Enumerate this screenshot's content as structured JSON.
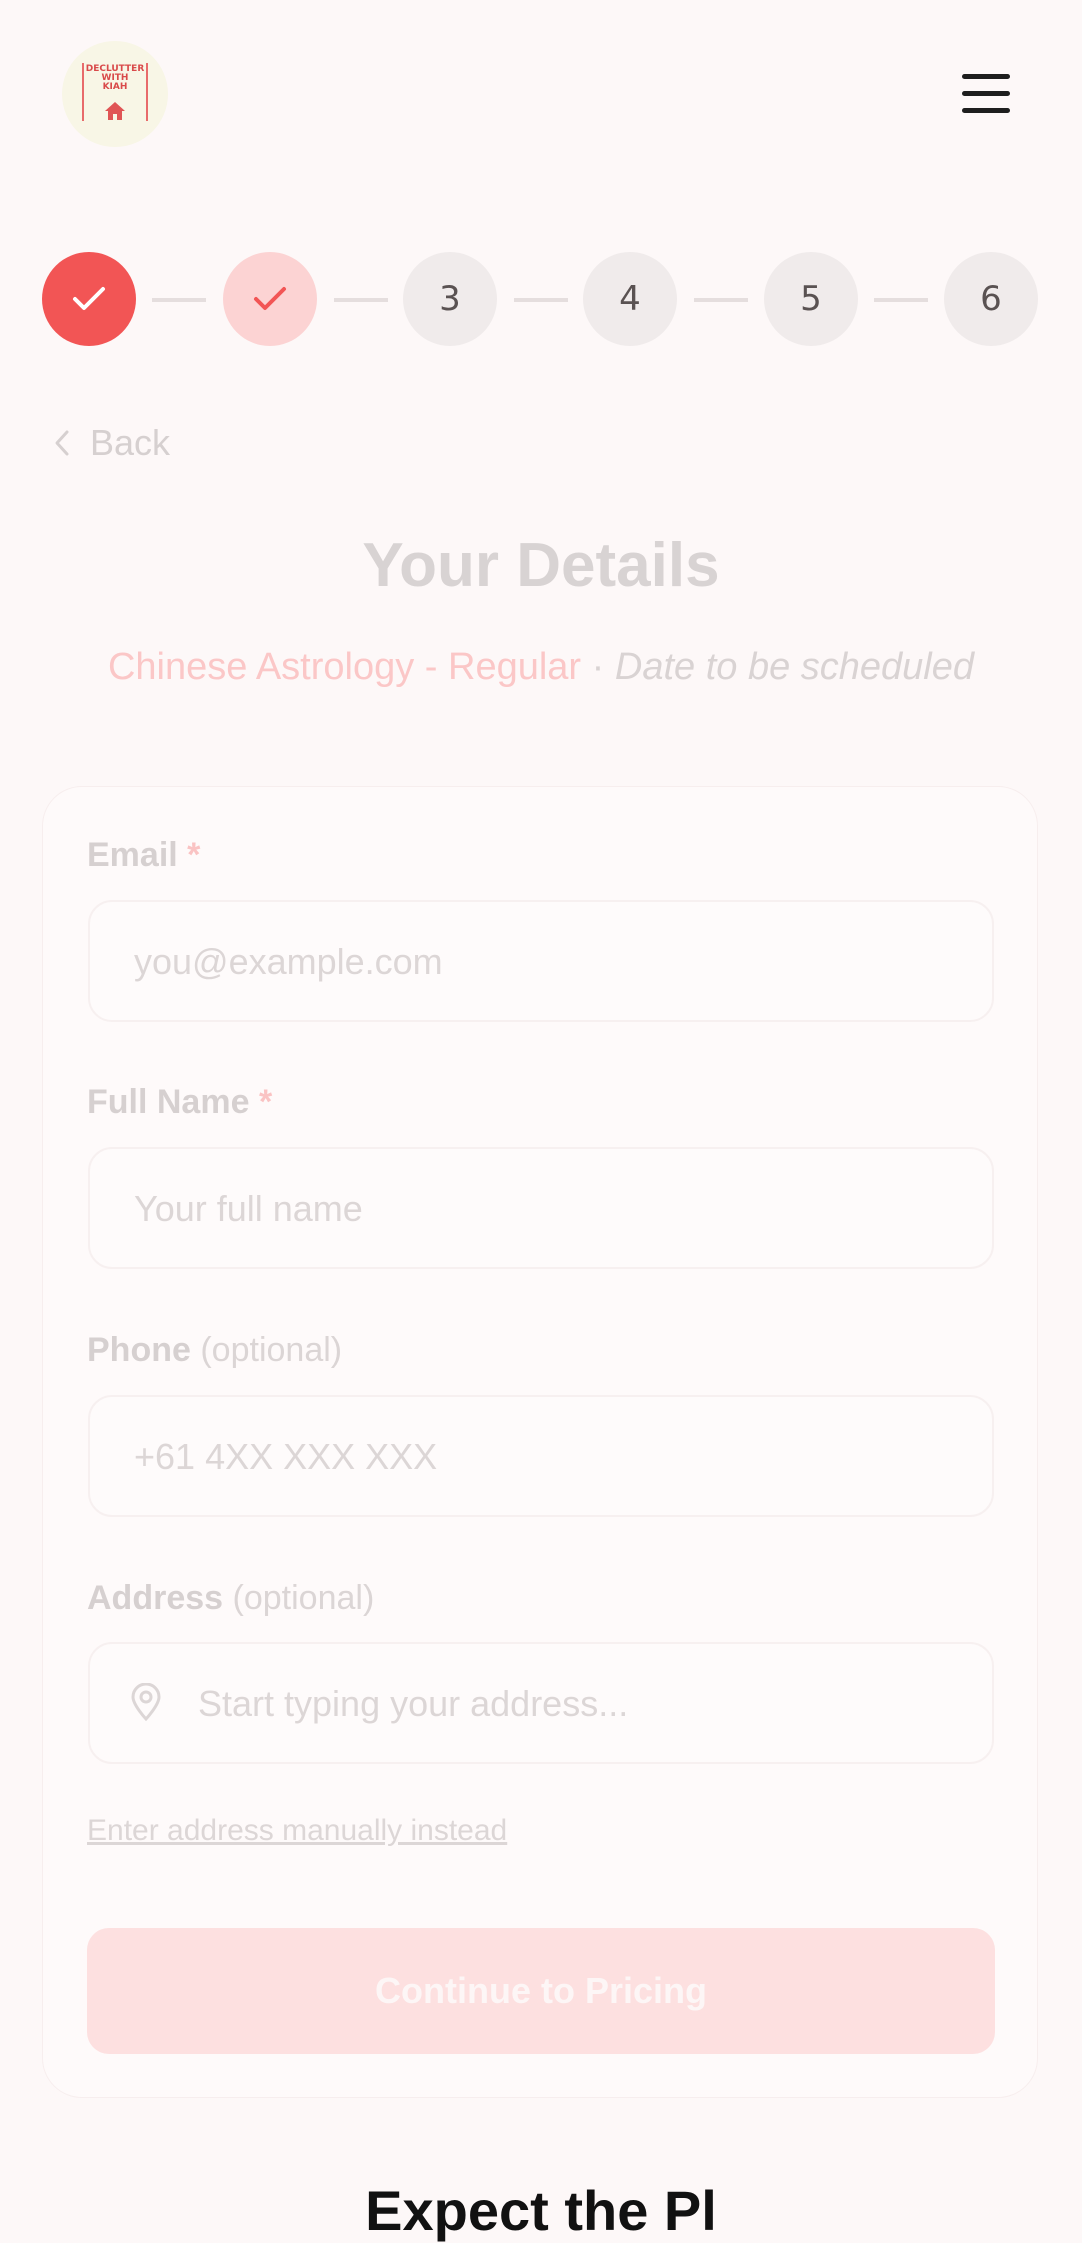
{
  "header": {
    "logo_text": [
      "DECLUTTER",
      "WITH",
      "KIAH"
    ],
    "menu_icon": "hamburger-menu-icon"
  },
  "stepper": {
    "steps": [
      {
        "label": "",
        "state": "completed",
        "icon": "check-icon"
      },
      {
        "label": "",
        "state": "current",
        "icon": "check-icon"
      },
      {
        "label": "3",
        "state": "pending"
      },
      {
        "label": "4",
        "state": "pending"
      },
      {
        "label": "5",
        "state": "pending"
      },
      {
        "label": "6",
        "state": "pending"
      }
    ],
    "colors": {
      "completed": "#f25555",
      "current": "#fcd3d3",
      "pending": "#f0ebeb"
    }
  },
  "back": {
    "label": "Back",
    "icon": "chevron-left-icon"
  },
  "page": {
    "title": "Your Details",
    "service": "Chinese Astrology - Regular",
    "separator": "·",
    "date_note": "Date to be scheduled"
  },
  "form": {
    "email": {
      "label": "Email",
      "required_mark": "*",
      "placeholder": "you@example.com",
      "value": ""
    },
    "full_name": {
      "label": "Full Name",
      "required_mark": "*",
      "placeholder": "Your full name",
      "value": ""
    },
    "phone": {
      "label": "Phone",
      "optional_note": "(optional)",
      "placeholder": "+61 4XX XXX XXX",
      "value": ""
    },
    "address": {
      "label": "Address",
      "optional_note": "(optional)",
      "placeholder": "Start typing your address...",
      "value": "",
      "icon": "map-pin-icon"
    },
    "manual_link": "Enter address manually instead",
    "submit_label": "Continue to Pricing"
  },
  "below_fold": {
    "heading_partial": "Expect the Pl"
  },
  "colors": {
    "accent": "#f25555",
    "button_disabled": "#fde0e0"
  }
}
